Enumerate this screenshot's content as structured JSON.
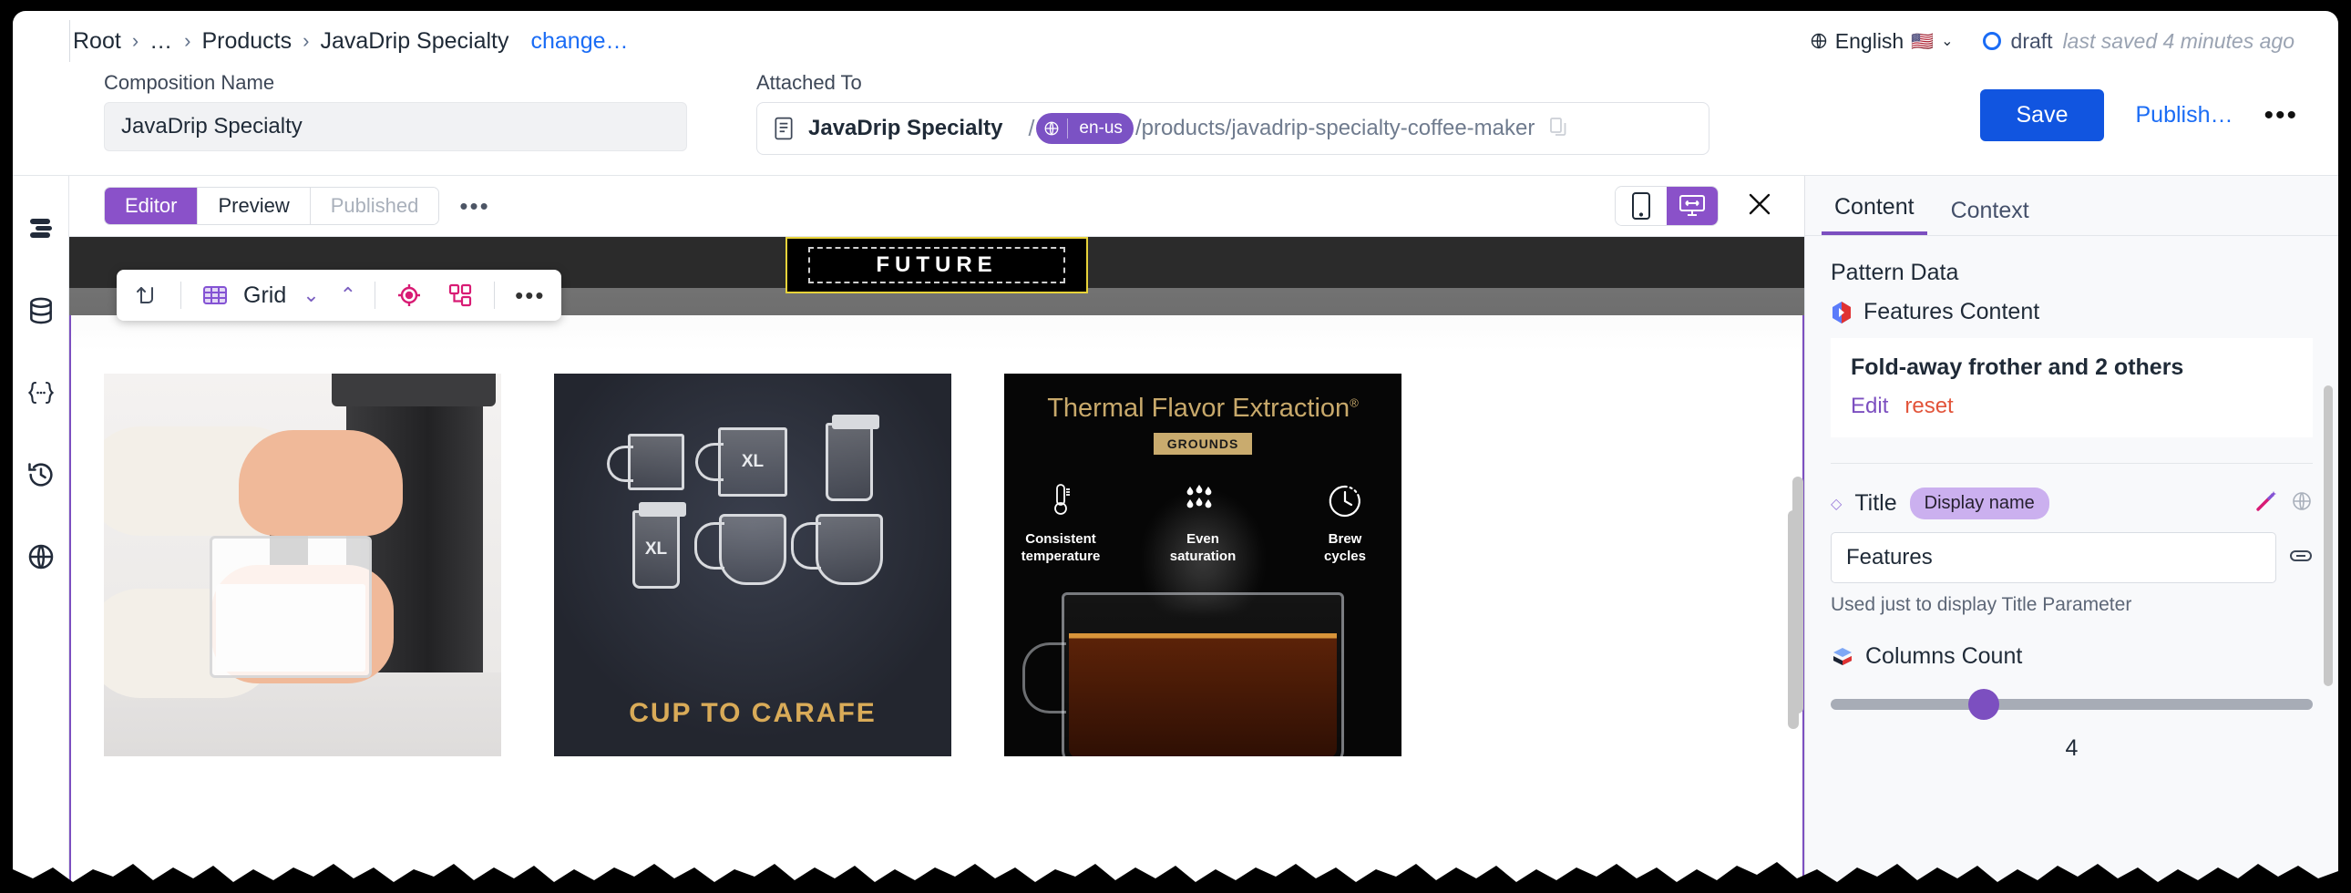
{
  "breadcrumb": {
    "items": [
      "Root",
      "…",
      "Products",
      "JavaDrip Specialty"
    ],
    "separator": "›",
    "change_link": "change…"
  },
  "header": {
    "language": "English",
    "language_flag": "🇺🇸",
    "status": "draft",
    "saved_text": "last saved 4 minutes ago",
    "save_label": "Save",
    "publish_label": "Publish…",
    "more_label": "•••"
  },
  "form": {
    "composition_label": "Composition Name",
    "composition_value": "JavaDrip Specialty",
    "composition_placeholder": "Composition Name",
    "attached_label": "Attached To",
    "attached_title": "JavaDrip Specialty",
    "slash": "/",
    "locale": "en-us",
    "url_path": "/products/javadrip-specialty-coffee-maker"
  },
  "rail": {
    "items": [
      {
        "name": "menu-lines-icon",
        "label": "Components"
      },
      {
        "name": "database-icon",
        "label": "Data"
      },
      {
        "name": "curly-braces-icon",
        "label": "Parameters"
      },
      {
        "name": "history-icon",
        "label": "History"
      },
      {
        "name": "globe-icon",
        "label": "Locales"
      }
    ]
  },
  "editor": {
    "tabs": [
      {
        "label": "Editor",
        "state": "active"
      },
      {
        "label": "Preview",
        "state": "normal"
      },
      {
        "label": "Published",
        "state": "disabled"
      }
    ],
    "more_label": "•••",
    "devices": [
      {
        "name": "mobile-device-icon",
        "active": false
      },
      {
        "name": "desktop-responsive-icon",
        "active": true
      }
    ],
    "close_label": "✕"
  },
  "canvas_toolbar": {
    "move_up_icon": "arrow-up-left-icon",
    "type_icon": "grid-icon",
    "type_label": "Grid",
    "chevron_down": "⌄",
    "chevron_up": "⌃",
    "target_icon": "target-icon",
    "structure_icon": "structure-icon",
    "more_label": "•••"
  },
  "preview": {
    "hero_badge": "FUTURE",
    "cards": [
      {
        "name": "frother-photo-card",
        "caption": ""
      },
      {
        "name": "cup-to-carafe-card",
        "title": "CUP TO CARAFE",
        "vessels": [
          "",
          "XL",
          "",
          "XL",
          "",
          ""
        ]
      },
      {
        "name": "thermal-flavor-card",
        "title": "Thermal Flavor Extraction",
        "trademark": "®",
        "badge": "GROUNDS",
        "features": [
          {
            "icon": "thermometer-icon",
            "line1": "Consistent",
            "line2": "temperature"
          },
          {
            "icon": "droplets-icon",
            "line1": "Even",
            "line2": "saturation"
          },
          {
            "icon": "brew-clock-icon",
            "line1": "Brew",
            "line2": "cycles"
          }
        ]
      }
    ]
  },
  "right_panel": {
    "tabs": [
      {
        "label": "Content",
        "active": true
      },
      {
        "label": "Context",
        "active": false
      }
    ],
    "pattern_data_heading": "Pattern Data",
    "features_content_label": "Features Content",
    "features_value": "Fold-away frother and 2 others",
    "edit_label": "Edit",
    "reset_label": "reset",
    "title_param": {
      "name": "Title",
      "badge": "Display name",
      "value": "Features",
      "hint": "Used just to display Title Parameter"
    },
    "columns_param": {
      "name": "Columns Count",
      "value": "4"
    }
  },
  "colors": {
    "accent_purple": "#7c4fc0",
    "primary_blue": "#1155e0",
    "link_blue": "#1a6cf5",
    "reset_red": "#e2543a",
    "pill_purple": "#7b52c4"
  }
}
